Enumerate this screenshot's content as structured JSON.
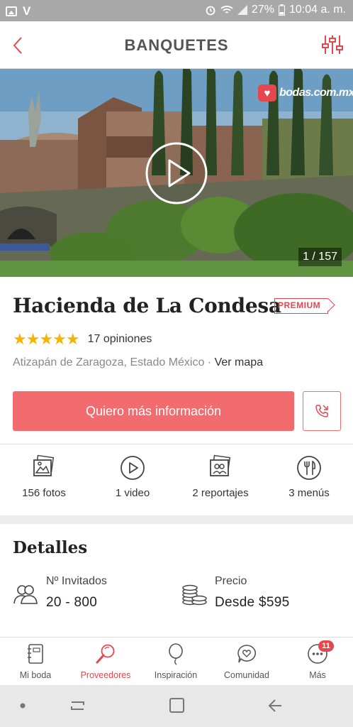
{
  "status_bar": {
    "battery": "27%",
    "time": "10:04 a. m."
  },
  "header": {
    "title": "BANQUETES"
  },
  "hero": {
    "brand": "bodas.com.mx",
    "counter": "1 / 157"
  },
  "venue": {
    "name": "Hacienda de La Condesa",
    "badge": "PREMIUM",
    "rating_stars": 5,
    "stars_display": "★★★★★",
    "reviews": "17 opiniones",
    "location": "Atizapán de Zaragoza, Estado México",
    "separator": " · ",
    "map_link": "Ver mapa"
  },
  "actions": {
    "cta": "Quiero más información"
  },
  "media": [
    {
      "icon": "photos-icon",
      "label": "156 fotos"
    },
    {
      "icon": "video-icon",
      "label": "1 video"
    },
    {
      "icon": "reports-icon",
      "label": "2 reportajes"
    },
    {
      "icon": "menu-icon",
      "label": "3 menús"
    }
  ],
  "details": {
    "title": "Detalles",
    "guests": {
      "label": "Nº Invitados",
      "value": "20 - 800"
    },
    "price": {
      "label": "Precio",
      "value": "Desde $595"
    }
  },
  "bottom_nav": [
    {
      "label": "Mi boda",
      "icon": "notebook-icon"
    },
    {
      "label": "Proveedores",
      "icon": "search-icon",
      "active": true
    },
    {
      "label": "Inspiración",
      "icon": "balloon-icon"
    },
    {
      "label": "Comunidad",
      "icon": "chat-heart-icon"
    },
    {
      "label": "Más",
      "icon": "more-icon",
      "badge": "11"
    }
  ],
  "colors": {
    "accent": "#e4474e",
    "cta": "#f26b6e",
    "star": "#f4b400"
  }
}
